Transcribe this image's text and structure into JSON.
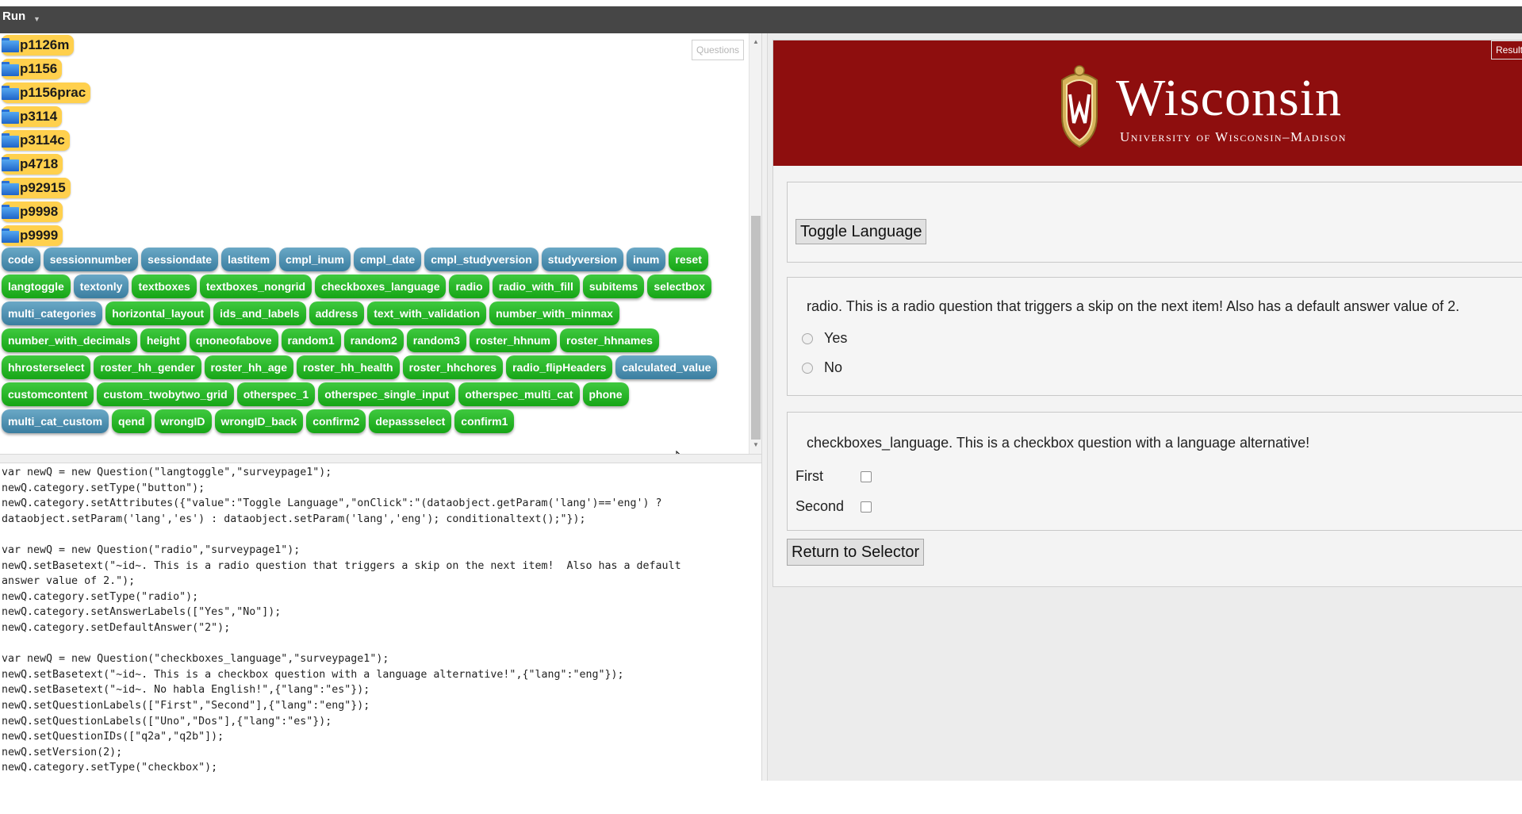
{
  "toolbar": {
    "run_label": "Run",
    "run_caret": "▼"
  },
  "selector": {
    "questions_label": "Questions",
    "folders": [
      "p1126m",
      "p1156",
      "p1156prac",
      "p3114",
      "p3114c",
      "p4718",
      "p92915",
      "p9998",
      "p9999"
    ],
    "button_rows": [
      [
        {
          "label": "code",
          "color": "blue"
        },
        {
          "label": "sessionnumber",
          "color": "blue"
        },
        {
          "label": "sessiondate",
          "color": "blue"
        },
        {
          "label": "lastitem",
          "color": "blue"
        },
        {
          "label": "cmpl_inum",
          "color": "blue"
        },
        {
          "label": "cmpl_date",
          "color": "blue"
        },
        {
          "label": "cmpl_studyversion",
          "color": "blue"
        },
        {
          "label": "studyversion",
          "color": "blue"
        },
        {
          "label": "inum",
          "color": "blue"
        },
        {
          "label": "reset",
          "color": "green"
        }
      ],
      [
        {
          "label": "langtoggle",
          "color": "green"
        },
        {
          "label": "textonly",
          "color": "blue"
        },
        {
          "label": "textboxes",
          "color": "green"
        },
        {
          "label": "textboxes_nongrid",
          "color": "green"
        },
        {
          "label": "checkboxes_language",
          "color": "green"
        },
        {
          "label": "radio",
          "color": "green"
        },
        {
          "label": "radio_with_fill",
          "color": "green"
        },
        {
          "label": "subitems",
          "color": "green"
        },
        {
          "label": "selectbox",
          "color": "green"
        }
      ],
      [
        {
          "label": "multi_categories",
          "color": "blue"
        },
        {
          "label": "horizontal_layout",
          "color": "green"
        },
        {
          "label": "ids_and_labels",
          "color": "green"
        },
        {
          "label": "address",
          "color": "green"
        },
        {
          "label": "text_with_validation",
          "color": "green"
        },
        {
          "label": "number_with_minmax",
          "color": "green"
        }
      ],
      [
        {
          "label": "number_with_decimals",
          "color": "green"
        },
        {
          "label": "height",
          "color": "green"
        },
        {
          "label": "qnoneofabove",
          "color": "green"
        },
        {
          "label": "random1",
          "color": "green"
        },
        {
          "label": "random2",
          "color": "green"
        },
        {
          "label": "random3",
          "color": "green"
        },
        {
          "label": "roster_hhnum",
          "color": "green"
        },
        {
          "label": "roster_hhnames",
          "color": "green"
        }
      ],
      [
        {
          "label": "hhrosterselect",
          "color": "green"
        },
        {
          "label": "roster_hh_gender",
          "color": "green"
        },
        {
          "label": "roster_hh_age",
          "color": "green"
        },
        {
          "label": "roster_hh_health",
          "color": "green"
        },
        {
          "label": "roster_hhchores",
          "color": "green"
        },
        {
          "label": "radio_flipHeaders",
          "color": "green"
        },
        {
          "label": "calculated_value",
          "color": "blue"
        }
      ],
      [
        {
          "label": "customcontent",
          "color": "green"
        },
        {
          "label": "custom_twobytwo_grid",
          "color": "green"
        },
        {
          "label": "otherspec_1",
          "color": "green"
        },
        {
          "label": "otherspec_single_input",
          "color": "green"
        },
        {
          "label": "otherspec_multi_cat",
          "color": "green"
        },
        {
          "label": "phone",
          "color": "green"
        }
      ],
      [
        {
          "label": "multi_cat_custom",
          "color": "blue"
        },
        {
          "label": "qend",
          "color": "green"
        },
        {
          "label": "wrongID",
          "color": "green"
        },
        {
          "label": "wrongID_back",
          "color": "green"
        },
        {
          "label": "confirm2",
          "color": "green"
        },
        {
          "label": "depassselect",
          "color": "green"
        },
        {
          "label": "confirm1",
          "color": "green"
        }
      ]
    ]
  },
  "code_lines": [
    "var newQ = new Question(\"langtoggle\",\"surveypage1\");",
    "newQ.category.setType(\"button\");",
    "newQ.category.setAttributes({\"value\":\"Toggle Language\",\"onClick\":\"(dataobject.getParam('lang')=='eng') ?",
    "dataobject.setParam('lang','es') : dataobject.setParam('lang','eng'); conditionaltext();\"});",
    "",
    "var newQ = new Question(\"radio\",\"surveypage1\");",
    "newQ.setBasetext(\"~id~. This is a radio question that triggers a skip on the next item!  Also has a default",
    "answer value of 2.\");",
    "newQ.category.setType(\"radio\");",
    "newQ.category.setAnswerLabels([\"Yes\",\"No\"]);",
    "newQ.category.setDefaultAnswer(\"2\");",
    "",
    "var newQ = new Question(\"checkboxes_language\",\"surveypage1\");",
    "newQ.setBasetext(\"~id~. This is a checkbox question with a language alternative!\",{\"lang\":\"eng\"});",
    "newQ.setBasetext(\"~id~. No habla English!\",{\"lang\":\"es\"});",
    "newQ.setQuestionLabels([\"First\",\"Second\"],{\"lang\":\"eng\"});",
    "newQ.setQuestionLabels([\"Uno\",\"Dos\"],{\"lang\":\"es\"});",
    "newQ.setQuestionIDs([\"q2a\",\"q2b\"]);",
    "newQ.setVersion(2);",
    "newQ.category.setType(\"checkbox\");"
  ],
  "result": {
    "result_label": "Result",
    "banner": {
      "wordmark": "Wisconsin",
      "subtitle": "University of Wisconsin–Madison",
      "color": "#8e0e0e"
    },
    "toggle_label": "Toggle Language",
    "radio_question": "radio. This is a radio question that triggers a skip on the next item! Also has a default answer value of 2.",
    "radio_options": [
      "Yes",
      "No"
    ],
    "checkbox_question": "checkboxes_language. This is a checkbox question with a language alternative!",
    "checkbox_options": [
      "First",
      "Second"
    ],
    "return_label": "Return to Selector"
  },
  "colors": {
    "button_blue": "#3b7ea0",
    "button_green": "#16a516",
    "folder_yellow": "#ffd04d",
    "topbar": "#464646"
  }
}
